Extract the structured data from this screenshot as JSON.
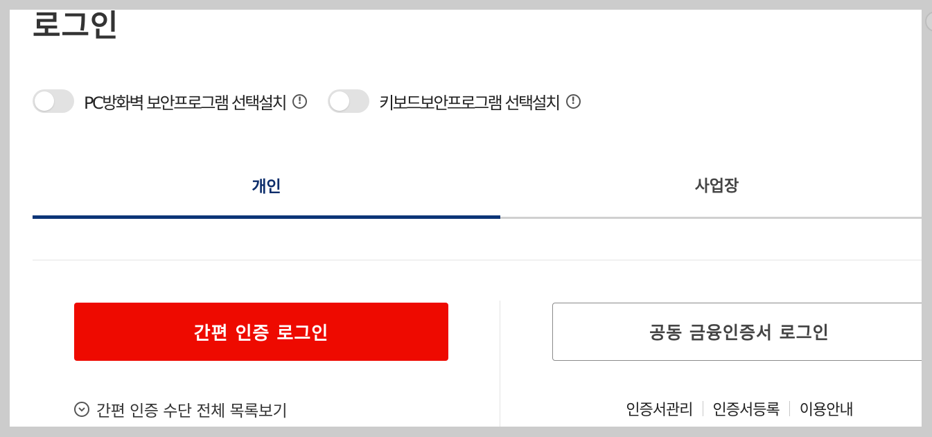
{
  "page": {
    "title": "로그인"
  },
  "toggles": [
    {
      "label": "PC방화벽 보안프로그램 선택설치",
      "on": false,
      "info_icon": "info-circle-icon"
    },
    {
      "label": "키보드보안프로그램 선택설치",
      "on": false,
      "info_icon": "info-circle-icon"
    }
  ],
  "tabs": {
    "personal": "개인",
    "business": "사업장",
    "active": "personal"
  },
  "buttons": {
    "simple_auth": "간편 인증 로그인",
    "joint_cert": "공동 금융인증서 로그인"
  },
  "simple_auth_list": {
    "icon": "chevron-down-circle-icon",
    "label": "간편 인증 수단 전체 목록보기"
  },
  "cert_links": [
    "인증서관리",
    "인증서등록",
    "이용안내"
  ],
  "colors": {
    "primary_red": "#ee0a00",
    "navy": "#0c3577",
    "tab_inactive_line": "#d0d0d0"
  }
}
